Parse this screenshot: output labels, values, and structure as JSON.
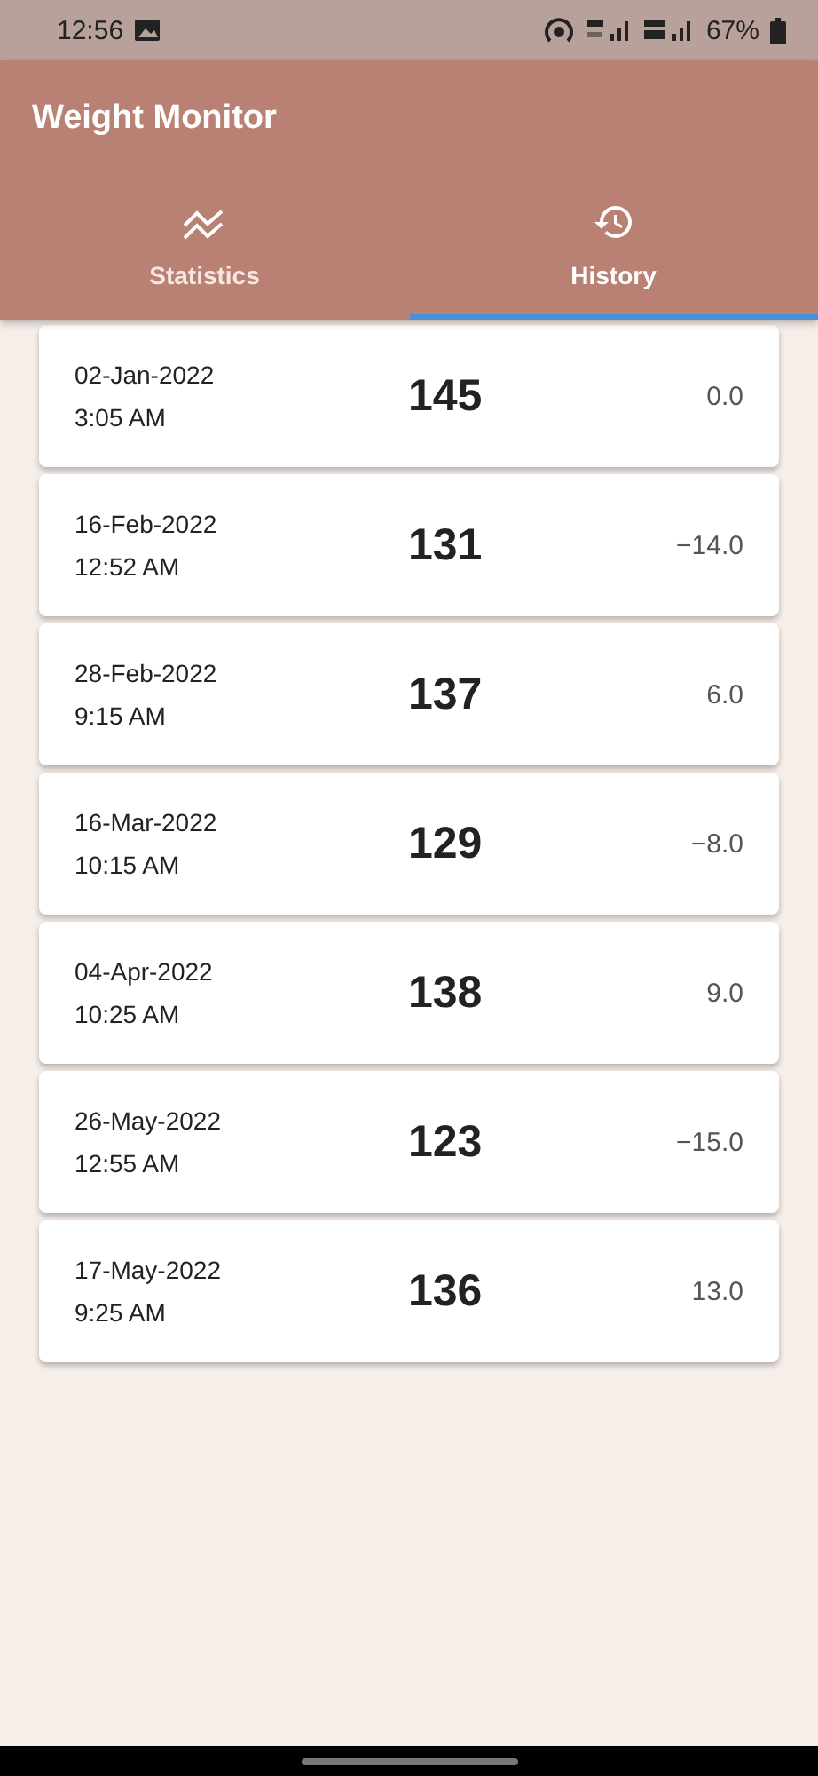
{
  "status_bar": {
    "time": "12:56",
    "battery": "67%"
  },
  "app_bar": {
    "title": "Weight Monitor"
  },
  "tabs": [
    {
      "label": "Statistics",
      "kind": "chart",
      "selected": false
    },
    {
      "label": "History",
      "kind": "history",
      "selected": true
    }
  ],
  "entries": [
    {
      "date": "02-Jan-2022",
      "time": "3:05 AM",
      "weight": "145",
      "change": "0.0"
    },
    {
      "date": "16-Feb-2022",
      "time": "12:52 AM",
      "weight": "131",
      "change": "−14.0"
    },
    {
      "date": "28-Feb-2022",
      "time": "9:15 AM",
      "weight": "137",
      "change": "6.0"
    },
    {
      "date": "16-Mar-2022",
      "time": "10:15 AM",
      "weight": "129",
      "change": "−8.0"
    },
    {
      "date": "04-Apr-2022",
      "time": "10:25 AM",
      "weight": "138",
      "change": "9.0"
    },
    {
      "date": "26-May-2022",
      "time": "12:55 AM",
      "weight": "123",
      "change": "−15.0"
    },
    {
      "date": "17-May-2022",
      "time": "9:25 AM",
      "weight": "136",
      "change": "13.0"
    }
  ]
}
